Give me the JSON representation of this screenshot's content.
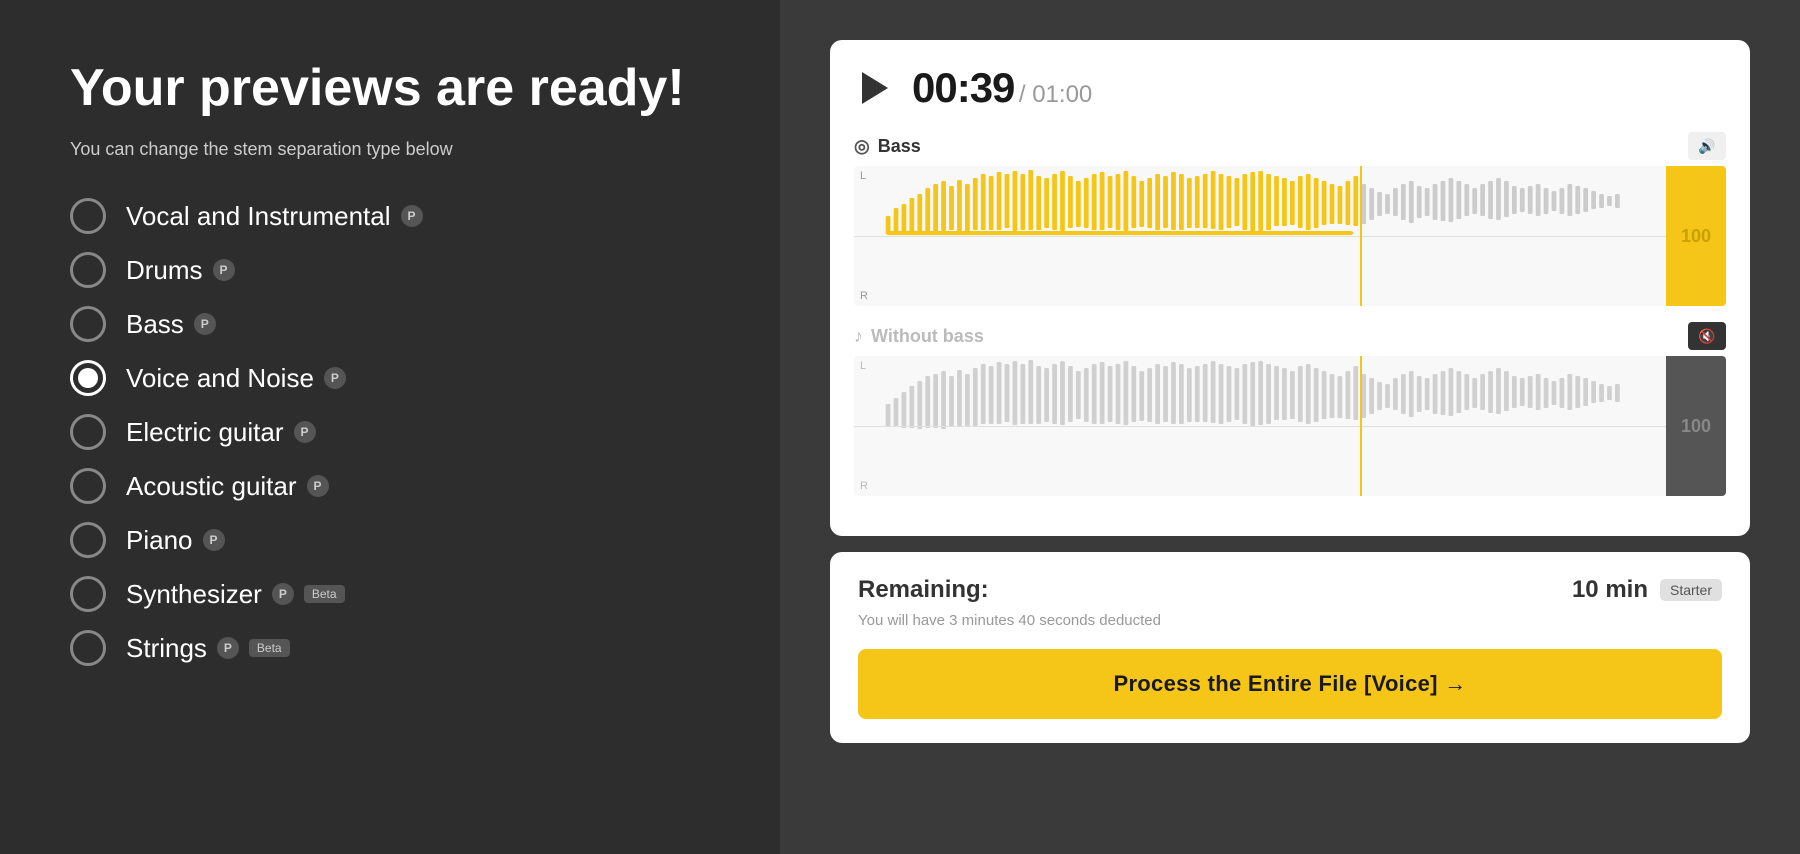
{
  "page": {
    "title": "Your previews are ready!",
    "subtitle": "You can change the stem separation type below"
  },
  "options": [
    {
      "id": "vocal-instrumental",
      "label": "Vocal and Instrumental",
      "pro": true,
      "beta": false,
      "selected": false
    },
    {
      "id": "drums",
      "label": "Drums",
      "pro": true,
      "beta": false,
      "selected": false
    },
    {
      "id": "bass",
      "label": "Bass",
      "pro": true,
      "beta": false,
      "selected": false
    },
    {
      "id": "voice-noise",
      "label": "Voice and Noise",
      "pro": true,
      "beta": false,
      "selected": true
    },
    {
      "id": "electric-guitar",
      "label": "Electric guitar",
      "pro": true,
      "beta": false,
      "selected": false
    },
    {
      "id": "acoustic-guitar",
      "label": "Acoustic guitar",
      "pro": true,
      "beta": false,
      "selected": false
    },
    {
      "id": "piano",
      "label": "Piano",
      "pro": true,
      "beta": false,
      "selected": false
    },
    {
      "id": "synthesizer",
      "label": "Synthesizer",
      "pro": true,
      "beta": true,
      "selected": false
    },
    {
      "id": "strings",
      "label": "Strings",
      "pro": true,
      "beta": true,
      "selected": false
    }
  ],
  "player": {
    "current_time": "00:39",
    "total_time": "/ 01:00",
    "tracks": [
      {
        "name": "Bass",
        "type": "instrument",
        "muted": false
      },
      {
        "name": "Without bass",
        "type": "minus",
        "muted": true
      }
    ]
  },
  "remaining": {
    "label": "Remaining:",
    "value": "10 min",
    "tier": "Starter",
    "deduction_note": "You will have 3 minutes 40 seconds deducted"
  },
  "process_button": {
    "label": "Process the Entire File [Voice] →"
  },
  "icons": {
    "pro": "P",
    "mute": "🔇",
    "speaker": "🔊",
    "bass_icon": "◎",
    "music_note": "♪",
    "play": "▶"
  },
  "colors": {
    "accent": "#f5c518",
    "background": "#2d2d2d",
    "card_bg": "#ffffff",
    "waveform_active": "#f5c518",
    "waveform_inactive": "#cccccc"
  }
}
